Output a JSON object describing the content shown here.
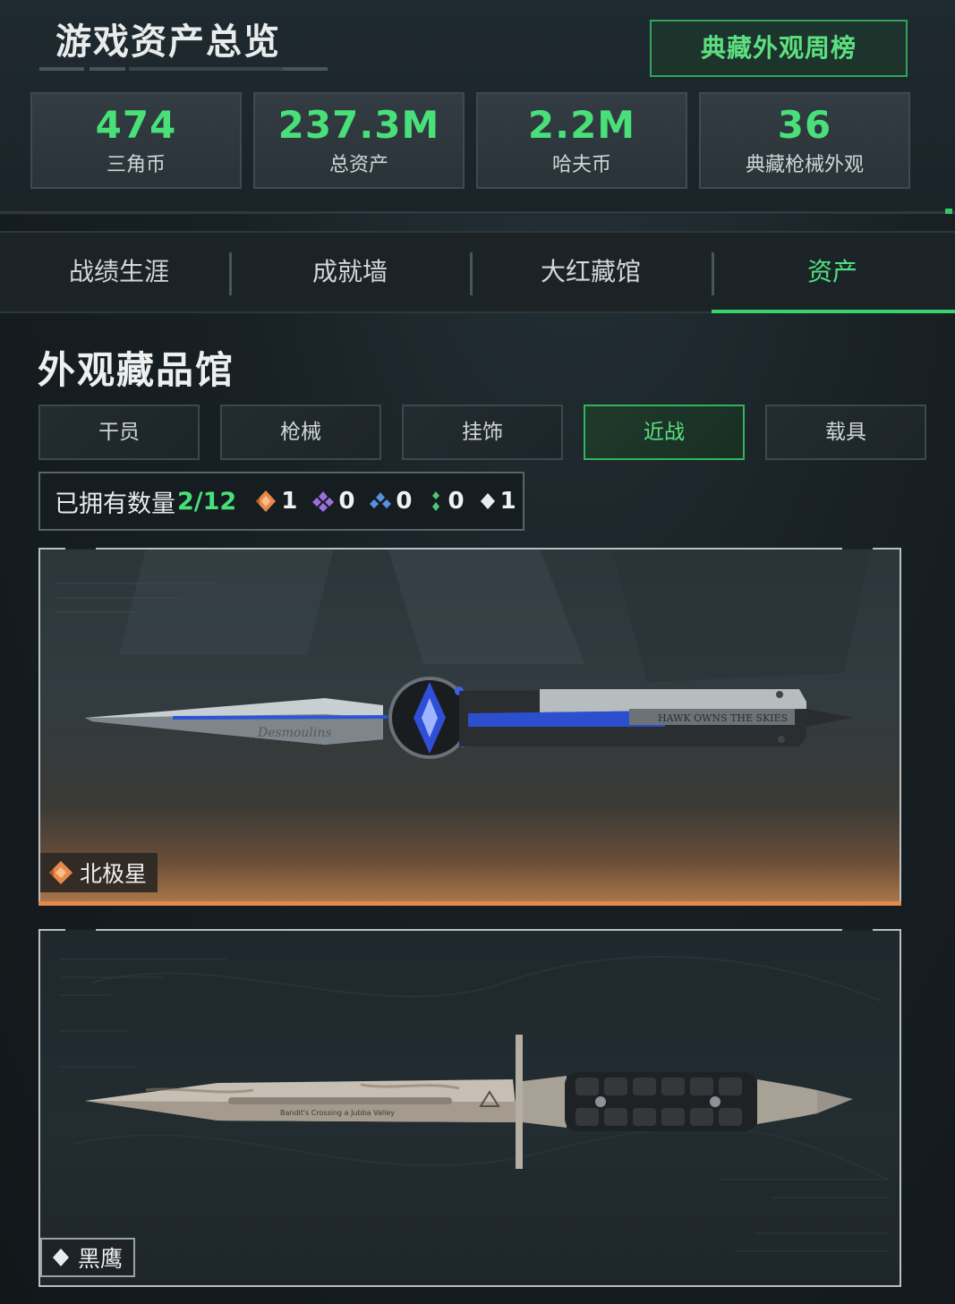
{
  "header": {
    "title": "游戏资产总览",
    "weekly_button": "典藏外观周榜",
    "stats": [
      {
        "value": "474",
        "label": "三角币"
      },
      {
        "value": "237.3M",
        "label": "总资产"
      },
      {
        "value": "2.2M",
        "label": "哈夫币"
      },
      {
        "value": "36",
        "label": "典藏枪械外观"
      }
    ]
  },
  "tabs": [
    {
      "label": "战绩生涯",
      "active": false
    },
    {
      "label": "成就墙",
      "active": false
    },
    {
      "label": "大红藏馆",
      "active": false
    },
    {
      "label": "资产",
      "active": true
    }
  ],
  "section": {
    "title": "外观藏品馆",
    "categories": [
      {
        "label": "干员",
        "active": false
      },
      {
        "label": "枪械",
        "active": false
      },
      {
        "label": "挂饰",
        "active": false
      },
      {
        "label": "近战",
        "active": true
      },
      {
        "label": "载具",
        "active": false
      }
    ],
    "owned_label": "已拥有数量",
    "owned_count": "2/12",
    "rarity_counts": [
      {
        "icon": "orange-diamond-icon",
        "count": "1",
        "color": "#e8894a"
      },
      {
        "icon": "purple-diamond-icon",
        "count": "0",
        "color": "#9a6fe0"
      },
      {
        "icon": "blue-diamond-icon",
        "count": "0",
        "color": "#5b8fe0"
      },
      {
        "icon": "green-diamond-icon",
        "count": "0",
        "color": "#4fc777"
      },
      {
        "icon": "white-diamond-icon",
        "count": "1",
        "color": "#e8ecee"
      }
    ]
  },
  "items": [
    {
      "name": "北极星",
      "rarity_icon": "orange-diamond-icon",
      "blade_text": "Desmoulins",
      "handle_text": "HAWK OWNS THE SKIES"
    },
    {
      "name": "黑鹰",
      "rarity_icon": "white-diamond-icon",
      "blade_text": "Bandit's Crossing a Jubba Valley"
    }
  ],
  "colors": {
    "accent_green": "#49e07a",
    "tab_active": "#4fe07e",
    "card1_glow": "#e38a4a"
  }
}
